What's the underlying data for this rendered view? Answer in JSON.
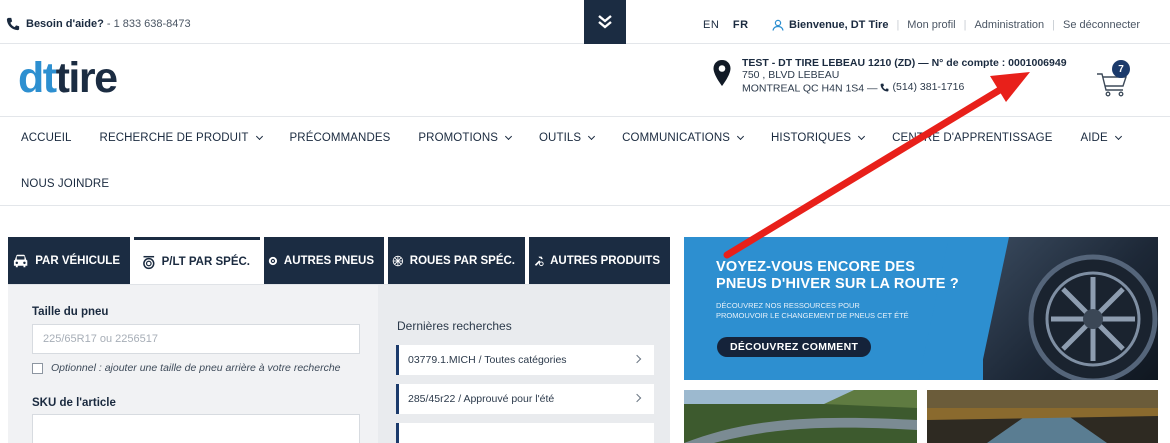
{
  "topbar": {
    "help_label": "Besoin d'aide?",
    "help_phone": " - 1 833 638-8473",
    "lang_en": "EN",
    "lang_fr": "FR",
    "welcome": "Bienvenue, DT Tire",
    "profile": "Mon profil",
    "admin": "Administration",
    "logout": "Se déconnecter"
  },
  "header": {
    "logo_dt": "dt",
    "logo_tire": "tire",
    "account_line1": "TEST - DT TIRE LEBEAU 1210 (ZD) — N° de compte : 0001006949",
    "account_line2": "750 ,  BLVD LEBEAU",
    "account_line3": "MONTREAL  QC  H4N 1S4  — ",
    "account_phone": "(514) 381-1716",
    "cart_count": "7"
  },
  "nav": {
    "items": [
      {
        "label": "ACCUEIL",
        "dropdown": false
      },
      {
        "label": "RECHERCHE DE PRODUIT",
        "dropdown": true
      },
      {
        "label": "PRÉCOMMANDES",
        "dropdown": false
      },
      {
        "label": "PROMOTIONS",
        "dropdown": true
      },
      {
        "label": "OUTILS",
        "dropdown": true
      },
      {
        "label": "COMMUNICATIONS",
        "dropdown": true
      },
      {
        "label": "HISTORIQUES",
        "dropdown": true
      },
      {
        "label": "CENTRE D'APPRENTISSAGE",
        "dropdown": false
      },
      {
        "label": "AIDE",
        "dropdown": true
      }
    ],
    "row2": "NOUS JOINDRE"
  },
  "tabs": [
    "PAR VÉHICULE",
    "P/LT PAR SPÉC.",
    "AUTRES PNEUS",
    "ROUES PAR SPÉC.",
    "AUTRES PRODUITS"
  ],
  "search": {
    "size_label": "Taille du pneu",
    "size_placeholder": "225/65R17 ou 2256517",
    "optional": "Optionnel : ajouter une taille de pneu arrière à votre recherche",
    "sku_label": "SKU de l'article",
    "recent_title": "Dernières recherches",
    "recent": [
      "03779.1.MICH / Toutes catégories",
      "285/45r22 / Approuvé pour l'été"
    ]
  },
  "banner": {
    "title_line1": "VOYEZ-VOUS ENCORE DES",
    "title_line2": "PNEUS D'HIVER SUR LA ROUTE ?",
    "sub_line1": "DÉCOUVREZ NOS RESSOURCES POUR",
    "sub_line2": "PROMOUVOIR LE CHANGEMENT DE PNEUS CET ÉTÉ",
    "cta": "DÉCOUVREZ COMMENT"
  },
  "colors": {
    "navy": "#1b2c42",
    "brand_blue": "#2d8fd0",
    "annotation_red": "#e8201a"
  }
}
